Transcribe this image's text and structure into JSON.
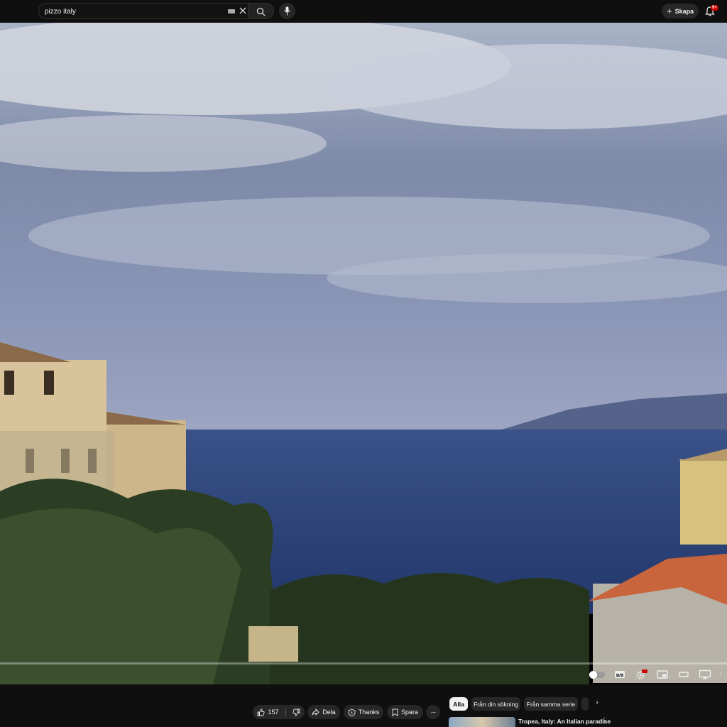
{
  "search": {
    "value": "pizzo italy"
  },
  "header": {
    "create_label": "Skapa",
    "notification_badge": "9+"
  },
  "actions": {
    "like_count": "157",
    "share_label": "Dela",
    "thanks_label": "Thanks",
    "save_label": "Spara"
  },
  "chips": [
    "Alla",
    "Från din sökning",
    "Från samma serie"
  ],
  "recommendation": {
    "title": "Tropea, Italy: An Italian paradise"
  },
  "colors": {
    "background": "#0f0f0f",
    "surface": "#272727",
    "badge": "#cc0000",
    "sea": "#2f4a86"
  }
}
